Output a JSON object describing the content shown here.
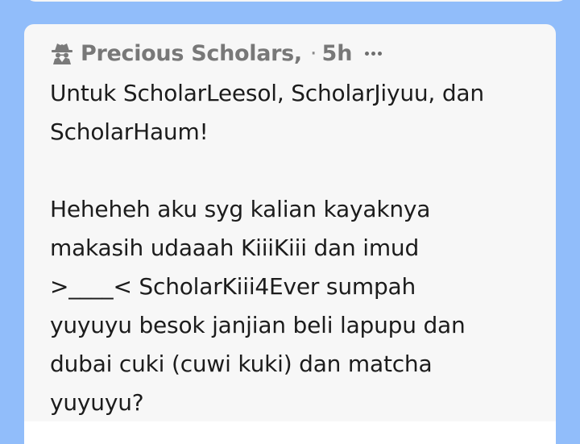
{
  "post": {
    "author": "Precious Scholars,",
    "separator": "·",
    "time": "5h",
    "author_icon": "incognito-spy-icon",
    "more_icon": "more-horizontal-icon",
    "body": "Untuk ScholarLeesol, ScholarJiyuu, dan\nScholarHaum!\n\nHeheheh aku syg kalian kayaknya\nmakasih udaaah KiiiKiii dan imud\n>____< ScholarKiii4Ever sumpah\nyuyuyu besok janjian beli lapupu dan\ndubai cuki (cuwi kuki) dan matcha\nyuyuyu?"
  },
  "colors": {
    "background": "#91bdfa",
    "card": "#f7f7f7",
    "author_text": "#787878",
    "body_text": "#1c1c1c"
  }
}
